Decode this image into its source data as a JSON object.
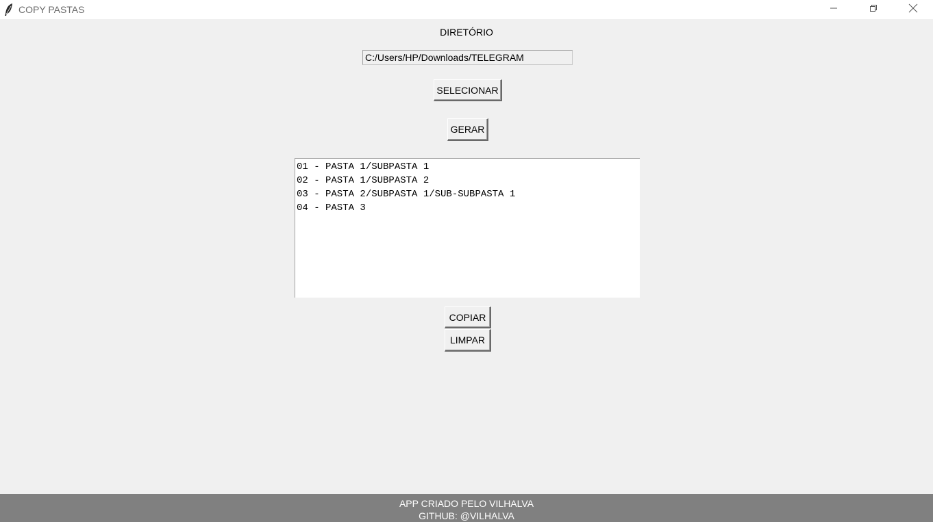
{
  "window": {
    "title": "COPY PASTAS",
    "icon": "feather-icon",
    "controls": {
      "minimize_icon": "minimize-icon",
      "maximize_icon": "restore-icon",
      "close_icon": "close-icon"
    }
  },
  "main": {
    "directory_label": "DIRETÓRIO",
    "directory_path": "C:/Users/HP/Downloads/TELEGRAM",
    "select_button": "SELECIONAR",
    "generate_button": "GERAR",
    "output_lines": [
      "01 - PASTA 1/SUBPASTA 1",
      "02 - PASTA 1/SUBPASTA 2",
      "03 - PASTA 2/SUBPASTA 1/SUB-SUBPASTA 1",
      "04 - PASTA 3"
    ],
    "copy_button": "COPIAR",
    "clear_button": "LIMPAR"
  },
  "footer": {
    "line1": "APP CRIADO PELO VILHALVA",
    "line2": "GITHUB: @VILHALVA"
  },
  "colors": {
    "background": "#f0f0f0",
    "footer_background": "#808080",
    "footer_text": "#ffffff"
  }
}
